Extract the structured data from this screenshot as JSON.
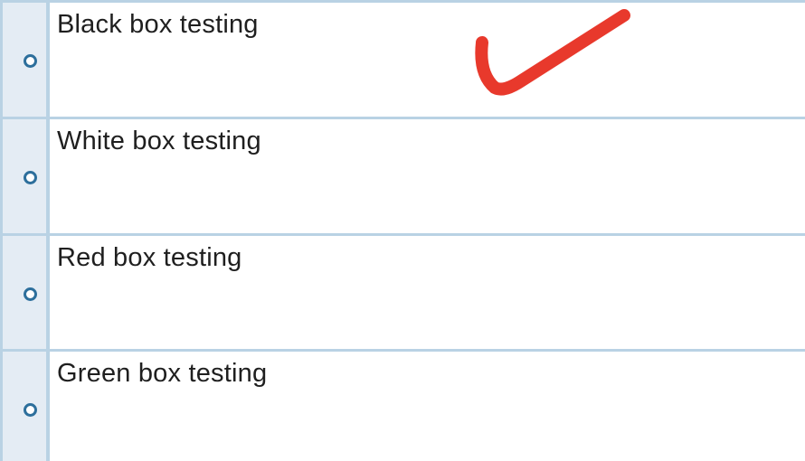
{
  "question": {
    "options": [
      {
        "label": "Black box testing",
        "selected": false
      },
      {
        "label": "White box testing",
        "selected": false
      },
      {
        "label": "Red box testing",
        "selected": false
      },
      {
        "label": "Green box testing",
        "selected": false
      }
    ]
  },
  "colors": {
    "border": "#b9d2e4",
    "radio_cell_bg": "#e4ecf4",
    "radio_ring": "#2d6f9c",
    "text": "#1f1f1f",
    "checkmark": "#e8392c"
  },
  "icons": {
    "radio": "radio-button-icon",
    "annotation": "red-checkmark-icon"
  }
}
